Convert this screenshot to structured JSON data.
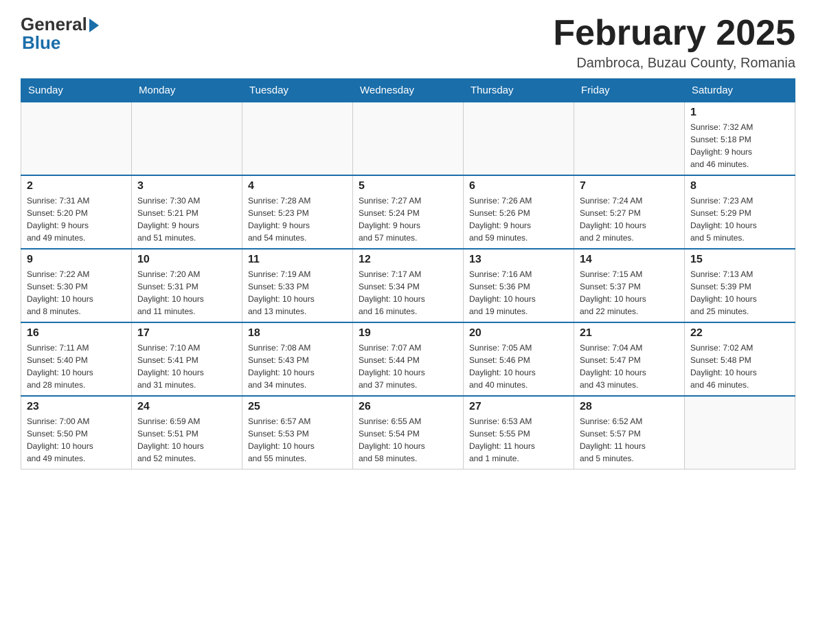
{
  "logo": {
    "general": "General",
    "blue": "Blue"
  },
  "title": "February 2025",
  "location": "Dambroca, Buzau County, Romania",
  "days_header": [
    "Sunday",
    "Monday",
    "Tuesday",
    "Wednesday",
    "Thursday",
    "Friday",
    "Saturday"
  ],
  "weeks": [
    [
      {
        "day": "",
        "info": ""
      },
      {
        "day": "",
        "info": ""
      },
      {
        "day": "",
        "info": ""
      },
      {
        "day": "",
        "info": ""
      },
      {
        "day": "",
        "info": ""
      },
      {
        "day": "",
        "info": ""
      },
      {
        "day": "1",
        "info": "Sunrise: 7:32 AM\nSunset: 5:18 PM\nDaylight: 9 hours\nand 46 minutes."
      }
    ],
    [
      {
        "day": "2",
        "info": "Sunrise: 7:31 AM\nSunset: 5:20 PM\nDaylight: 9 hours\nand 49 minutes."
      },
      {
        "day": "3",
        "info": "Sunrise: 7:30 AM\nSunset: 5:21 PM\nDaylight: 9 hours\nand 51 minutes."
      },
      {
        "day": "4",
        "info": "Sunrise: 7:28 AM\nSunset: 5:23 PM\nDaylight: 9 hours\nand 54 minutes."
      },
      {
        "day": "5",
        "info": "Sunrise: 7:27 AM\nSunset: 5:24 PM\nDaylight: 9 hours\nand 57 minutes."
      },
      {
        "day": "6",
        "info": "Sunrise: 7:26 AM\nSunset: 5:26 PM\nDaylight: 9 hours\nand 59 minutes."
      },
      {
        "day": "7",
        "info": "Sunrise: 7:24 AM\nSunset: 5:27 PM\nDaylight: 10 hours\nand 2 minutes."
      },
      {
        "day": "8",
        "info": "Sunrise: 7:23 AM\nSunset: 5:29 PM\nDaylight: 10 hours\nand 5 minutes."
      }
    ],
    [
      {
        "day": "9",
        "info": "Sunrise: 7:22 AM\nSunset: 5:30 PM\nDaylight: 10 hours\nand 8 minutes."
      },
      {
        "day": "10",
        "info": "Sunrise: 7:20 AM\nSunset: 5:31 PM\nDaylight: 10 hours\nand 11 minutes."
      },
      {
        "day": "11",
        "info": "Sunrise: 7:19 AM\nSunset: 5:33 PM\nDaylight: 10 hours\nand 13 minutes."
      },
      {
        "day": "12",
        "info": "Sunrise: 7:17 AM\nSunset: 5:34 PM\nDaylight: 10 hours\nand 16 minutes."
      },
      {
        "day": "13",
        "info": "Sunrise: 7:16 AM\nSunset: 5:36 PM\nDaylight: 10 hours\nand 19 minutes."
      },
      {
        "day": "14",
        "info": "Sunrise: 7:15 AM\nSunset: 5:37 PM\nDaylight: 10 hours\nand 22 minutes."
      },
      {
        "day": "15",
        "info": "Sunrise: 7:13 AM\nSunset: 5:39 PM\nDaylight: 10 hours\nand 25 minutes."
      }
    ],
    [
      {
        "day": "16",
        "info": "Sunrise: 7:11 AM\nSunset: 5:40 PM\nDaylight: 10 hours\nand 28 minutes."
      },
      {
        "day": "17",
        "info": "Sunrise: 7:10 AM\nSunset: 5:41 PM\nDaylight: 10 hours\nand 31 minutes."
      },
      {
        "day": "18",
        "info": "Sunrise: 7:08 AM\nSunset: 5:43 PM\nDaylight: 10 hours\nand 34 minutes."
      },
      {
        "day": "19",
        "info": "Sunrise: 7:07 AM\nSunset: 5:44 PM\nDaylight: 10 hours\nand 37 minutes."
      },
      {
        "day": "20",
        "info": "Sunrise: 7:05 AM\nSunset: 5:46 PM\nDaylight: 10 hours\nand 40 minutes."
      },
      {
        "day": "21",
        "info": "Sunrise: 7:04 AM\nSunset: 5:47 PM\nDaylight: 10 hours\nand 43 minutes."
      },
      {
        "day": "22",
        "info": "Sunrise: 7:02 AM\nSunset: 5:48 PM\nDaylight: 10 hours\nand 46 minutes."
      }
    ],
    [
      {
        "day": "23",
        "info": "Sunrise: 7:00 AM\nSunset: 5:50 PM\nDaylight: 10 hours\nand 49 minutes."
      },
      {
        "day": "24",
        "info": "Sunrise: 6:59 AM\nSunset: 5:51 PM\nDaylight: 10 hours\nand 52 minutes."
      },
      {
        "day": "25",
        "info": "Sunrise: 6:57 AM\nSunset: 5:53 PM\nDaylight: 10 hours\nand 55 minutes."
      },
      {
        "day": "26",
        "info": "Sunrise: 6:55 AM\nSunset: 5:54 PM\nDaylight: 10 hours\nand 58 minutes."
      },
      {
        "day": "27",
        "info": "Sunrise: 6:53 AM\nSunset: 5:55 PM\nDaylight: 11 hours\nand 1 minute."
      },
      {
        "day": "28",
        "info": "Sunrise: 6:52 AM\nSunset: 5:57 PM\nDaylight: 11 hours\nand 5 minutes."
      },
      {
        "day": "",
        "info": ""
      }
    ]
  ]
}
